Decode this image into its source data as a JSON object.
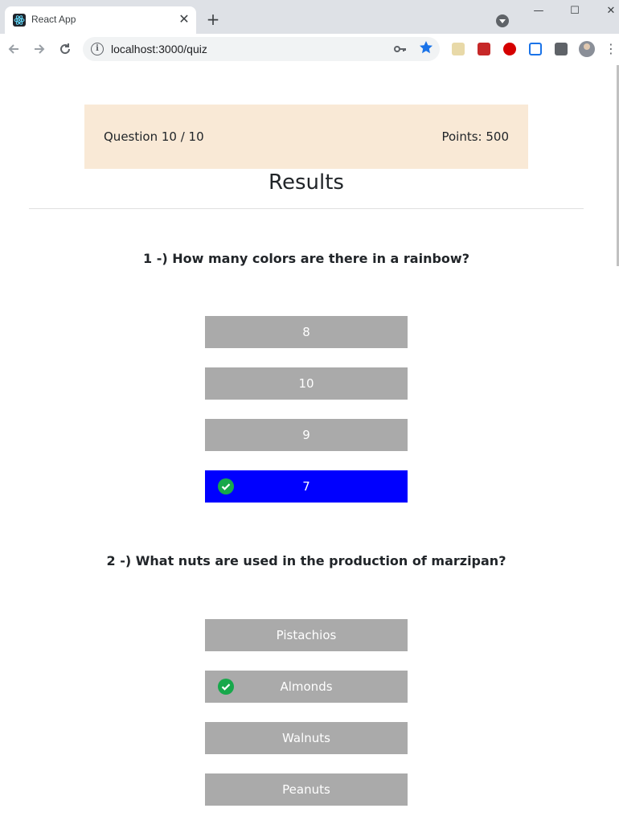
{
  "browser": {
    "tab_title": "React App",
    "tab_close": "✕",
    "new_tab": "+",
    "url": "localhost:3000/quiz",
    "window_controls": {
      "minimize": "—",
      "maximize": "☐",
      "close": "✕"
    }
  },
  "status": {
    "question_label": "Question 10 / 10",
    "points_label": "Points: 500"
  },
  "results_title": "Results",
  "questions": [
    {
      "text": "1 -) How many colors are there in a rainbow?",
      "answers": [
        {
          "label": "8",
          "selected": false,
          "correct": false
        },
        {
          "label": "10",
          "selected": false,
          "correct": false
        },
        {
          "label": "9",
          "selected": false,
          "correct": false
        },
        {
          "label": "7",
          "selected": true,
          "correct": true
        }
      ]
    },
    {
      "text": "2 -) What nuts are used in the production of marzipan?",
      "answers": [
        {
          "label": "Pistachios",
          "selected": false,
          "correct": false
        },
        {
          "label": "Almonds",
          "selected": false,
          "correct": true
        },
        {
          "label": "Walnuts",
          "selected": false,
          "correct": false
        },
        {
          "label": "Peanuts",
          "selected": false,
          "correct": false
        }
      ]
    }
  ],
  "colors": {
    "status_bg": "#f9e9d6",
    "answer_bg": "#aaaaaa",
    "selected_bg": "#0000ff",
    "check_green": "#17a84b"
  },
  "icons": {
    "back": "back-arrow-icon",
    "forward": "forward-arrow-icon",
    "reload": "reload-icon",
    "info": "info-icon",
    "key": "key-icon",
    "star": "star-icon",
    "check": "check-circle-icon"
  }
}
